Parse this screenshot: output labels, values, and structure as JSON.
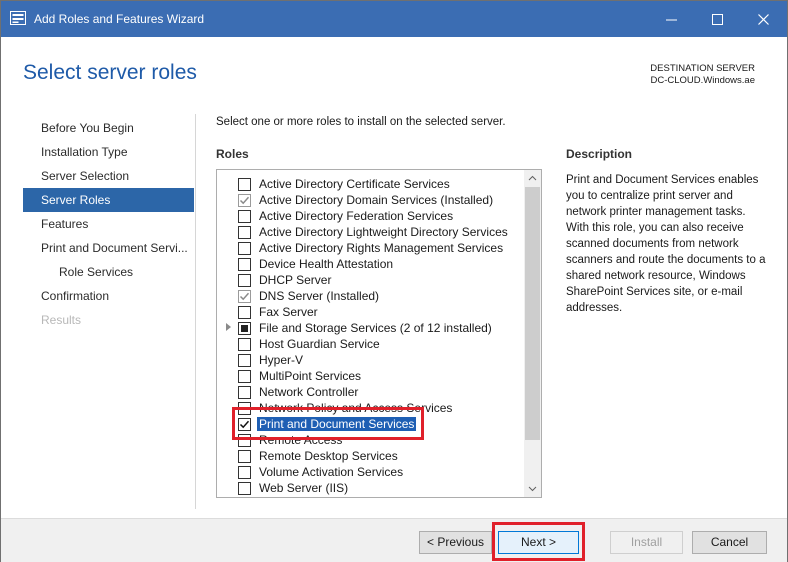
{
  "window": {
    "title": "Add Roles and Features Wizard"
  },
  "header": {
    "page_title": "Select server roles",
    "destination_label": "DESTINATION SERVER",
    "destination_server": "DC-CLOUD.Windows.ae"
  },
  "nav": {
    "items": [
      {
        "label": "Before You Begin",
        "state": "normal"
      },
      {
        "label": "Installation Type",
        "state": "normal"
      },
      {
        "label": "Server Selection",
        "state": "normal"
      },
      {
        "label": "Server Roles",
        "state": "active"
      },
      {
        "label": "Features",
        "state": "normal"
      },
      {
        "label": "Print and Document Servi...",
        "state": "normal"
      },
      {
        "label": "Role Services",
        "state": "sub"
      },
      {
        "label": "Confirmation",
        "state": "normal"
      },
      {
        "label": "Results",
        "state": "disabled"
      }
    ]
  },
  "content": {
    "instruction": "Select one or more roles to install on the selected server.",
    "roles_heading": "Roles",
    "roles": [
      {
        "label": "Active Directory Certificate Services",
        "state": "unchecked"
      },
      {
        "label": "Active Directory Domain Services (Installed)",
        "state": "checked-installed"
      },
      {
        "label": "Active Directory Federation Services",
        "state": "unchecked"
      },
      {
        "label": "Active Directory Lightweight Directory Services",
        "state": "unchecked"
      },
      {
        "label": "Active Directory Rights Management Services",
        "state": "unchecked"
      },
      {
        "label": "Device Health Attestation",
        "state": "unchecked"
      },
      {
        "label": "DHCP Server",
        "state": "unchecked"
      },
      {
        "label": "DNS Server (Installed)",
        "state": "checked-installed"
      },
      {
        "label": "Fax Server",
        "state": "unchecked"
      },
      {
        "label": "File and Storage Services (2 of 12 installed)",
        "state": "partial",
        "expandable": true
      },
      {
        "label": "Host Guardian Service",
        "state": "unchecked"
      },
      {
        "label": "Hyper-V",
        "state": "unchecked"
      },
      {
        "label": "MultiPoint Services",
        "state": "unchecked"
      },
      {
        "label": "Network Controller",
        "state": "unchecked"
      },
      {
        "label": "Network Policy and Access Services",
        "state": "unchecked"
      },
      {
        "label": "Print and Document Services",
        "state": "checked",
        "selected": true
      },
      {
        "label": "Remote Access",
        "state": "unchecked"
      },
      {
        "label": "Remote Desktop Services",
        "state": "unchecked"
      },
      {
        "label": "Volume Activation Services",
        "state": "unchecked"
      },
      {
        "label": "Web Server (IIS)",
        "state": "unchecked"
      }
    ],
    "description_heading": "Description",
    "description_text": "Print and Document Services enables you to centralize print server and network printer management tasks. With this role, you can also receive scanned documents from network scanners and route the documents to a shared network resource, Windows SharePoint Services site, or e-mail addresses."
  },
  "footer": {
    "previous_label": "< Previous",
    "next_label": "Next >",
    "install_label": "Install",
    "cancel_label": "Cancel"
  },
  "colors": {
    "titlebar": "#3b6db3",
    "accent": "#2c66a8",
    "highlight": "#e0202a"
  }
}
